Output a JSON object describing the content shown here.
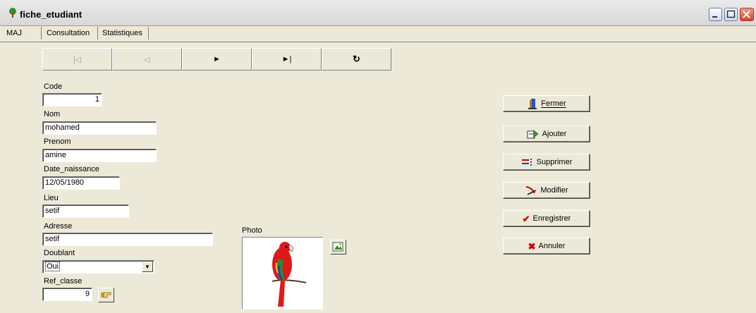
{
  "window": {
    "title": "fiche_etudiant"
  },
  "tabs": [
    {
      "label": "MAJ",
      "active": true
    },
    {
      "label": "Consultation",
      "active": false
    },
    {
      "label": "Statistiques",
      "active": false
    }
  ],
  "nav": {
    "first_icon": "|◁",
    "prev_icon": "◁",
    "next_icon": "►",
    "last_icon": "►|",
    "refresh_icon": "↻"
  },
  "form": {
    "code": {
      "label": "Code",
      "value": "1"
    },
    "nom": {
      "label": "Nom",
      "value": "mohamed"
    },
    "prenom": {
      "label": "Prenom",
      "value": "amine"
    },
    "date_naissance": {
      "label": "Date_naissance",
      "value": "12/05/1980"
    },
    "lieu": {
      "label": "Lieu",
      "value": "setif"
    },
    "adresse": {
      "label": "Adresse",
      "value": "setif"
    },
    "doublant": {
      "label": "Doublant",
      "value": "Oui"
    },
    "ref_classe": {
      "label": "Ref_classe",
      "value": "9"
    },
    "photo": {
      "label": "Photo"
    }
  },
  "actions": {
    "fermer": "Fermer",
    "ajouter": "Ajouter",
    "supprimer": "Supprimer",
    "modifier": "Modifier",
    "enregistrer": "Enregistrer",
    "annuler": "Annuler"
  },
  "colors": {
    "enregistrer_check": "#cc0000",
    "annuler_x": "#cc0000"
  }
}
